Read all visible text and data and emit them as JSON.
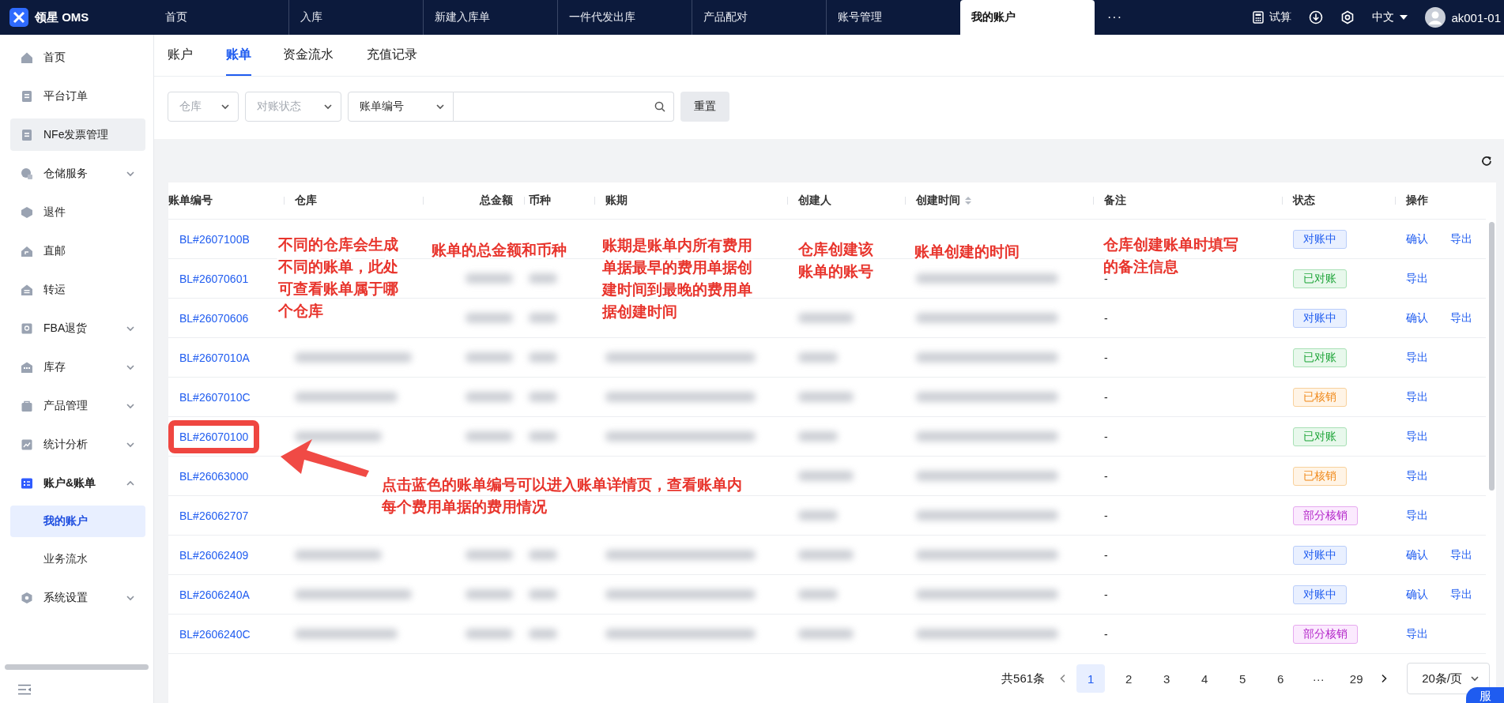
{
  "top_nav": {
    "logo": "领星 OMS",
    "tabs": [
      {
        "label": "首页",
        "selected": false
      },
      {
        "label": "入库",
        "selected": false
      },
      {
        "label": "新建入库单",
        "selected": false
      },
      {
        "label": "一件代发出库",
        "selected": false
      },
      {
        "label": "产品配对",
        "selected": false
      },
      {
        "label": "账号管理",
        "selected": false
      },
      {
        "label": "我的账户",
        "selected": true
      }
    ],
    "more": "···",
    "trial": "试算",
    "language": "中文",
    "user": "ak001-01"
  },
  "sidebar": {
    "items": [
      {
        "label": "首页",
        "kind": "link",
        "hovered": false
      },
      {
        "label": "平台订单",
        "kind": "link",
        "hovered": false
      },
      {
        "label": "NFe发票管理",
        "kind": "link",
        "hovered": true
      },
      {
        "label": "仓储服务",
        "kind": "group",
        "expanded": false,
        "hovered": false
      },
      {
        "label": "退件",
        "kind": "link",
        "hovered": false
      },
      {
        "label": "直邮",
        "kind": "link",
        "hovered": false
      },
      {
        "label": "转运",
        "kind": "link",
        "hovered": false
      },
      {
        "label": "FBA退货",
        "kind": "group",
        "expanded": false,
        "hovered": false
      },
      {
        "label": "库存",
        "kind": "group",
        "expanded": false,
        "hovered": false
      },
      {
        "label": "产品管理",
        "kind": "group",
        "expanded": false,
        "hovered": false
      },
      {
        "label": "统计分析",
        "kind": "group",
        "expanded": false,
        "hovered": false
      },
      {
        "label": "账户&账单",
        "kind": "group",
        "expanded": true,
        "hovered": false,
        "children": [
          {
            "label": "我的账户",
            "selected": true
          },
          {
            "label": "业务流水",
            "selected": false
          }
        ]
      },
      {
        "label": "系统设置",
        "kind": "group",
        "expanded": false,
        "hovered": false
      }
    ]
  },
  "sub_tabs": [
    {
      "label": "账户",
      "selected": false
    },
    {
      "label": "账单",
      "selected": true
    },
    {
      "label": "资金流水",
      "selected": false
    },
    {
      "label": "充值记录",
      "selected": false
    }
  ],
  "filters": {
    "warehouse": {
      "placeholder": "仓库"
    },
    "reconcile_status": {
      "placeholder": "对账状态"
    },
    "search_type": {
      "value": "账单编号"
    },
    "reset_button": "重置"
  },
  "table": {
    "columns": [
      {
        "label": "账单编号",
        "sortable": false
      },
      {
        "label": "仓库",
        "sortable": false
      },
      {
        "label": "总金额",
        "sortable": false
      },
      {
        "label": "币种",
        "sortable": false
      },
      {
        "label": "账期",
        "sortable": false
      },
      {
        "label": "创建人",
        "sortable": false
      },
      {
        "label": "创建时间",
        "sortable": true
      },
      {
        "label": "备注",
        "sortable": false
      },
      {
        "label": "状态",
        "sortable": false
      },
      {
        "label": "操作",
        "sortable": false
      }
    ],
    "rows": [
      {
        "bill_no": "BL#2607100B",
        "highlighted": false,
        "status": {
          "label": "对账中",
          "kind": "pending"
        },
        "actions": [
          "确认",
          "导出"
        ]
      },
      {
        "bill_no": "BL#26070601",
        "highlighted": false,
        "remark": "-",
        "status": {
          "label": "已对账",
          "kind": "reconciled"
        },
        "actions": [
          "导出"
        ]
      },
      {
        "bill_no": "BL#26070606",
        "highlighted": false,
        "remark": "-",
        "status": {
          "label": "对账中",
          "kind": "pending"
        },
        "actions": [
          "确认",
          "导出"
        ]
      },
      {
        "bill_no": "BL#2607010A",
        "highlighted": false,
        "remark": "-",
        "status": {
          "label": "已对账",
          "kind": "reconciled"
        },
        "actions": [
          "导出"
        ]
      },
      {
        "bill_no": "BL#2607010C",
        "highlighted": false,
        "remark": "-",
        "status": {
          "label": "已核销",
          "kind": "written_off"
        },
        "actions": [
          "导出"
        ]
      },
      {
        "bill_no": "BL#26070100",
        "highlighted": true,
        "remark": "-",
        "status": {
          "label": "已对账",
          "kind": "reconciled"
        },
        "actions": [
          "导出"
        ]
      },
      {
        "bill_no": "BL#26063000",
        "highlighted": false,
        "remark": "-",
        "status": {
          "label": "已核销",
          "kind": "written_off"
        },
        "actions": [
          "导出"
        ]
      },
      {
        "bill_no": "BL#26062707",
        "highlighted": false,
        "remark": "-",
        "status": {
          "label": "部分核销",
          "kind": "partial"
        },
        "actions": [
          "导出"
        ]
      },
      {
        "bill_no": "BL#26062409",
        "highlighted": false,
        "remark": "-",
        "status": {
          "label": "对账中",
          "kind": "pending"
        },
        "actions": [
          "确认",
          "导出"
        ]
      },
      {
        "bill_no": "BL#2606240A",
        "highlighted": false,
        "remark": "-",
        "status": {
          "label": "对账中",
          "kind": "pending"
        },
        "actions": [
          "确认",
          "导出"
        ]
      },
      {
        "bill_no": "BL#2606240C",
        "highlighted": false,
        "remark": "-",
        "status": {
          "label": "部分核销",
          "kind": "partial"
        },
        "actions": [
          "导出"
        ]
      }
    ]
  },
  "pagination": {
    "total": "共561条",
    "pages": [
      {
        "label": "1",
        "selected": true
      },
      {
        "label": "2",
        "selected": false
      },
      {
        "label": "3",
        "selected": false
      },
      {
        "label": "4",
        "selected": false
      },
      {
        "label": "5",
        "selected": false
      },
      {
        "label": "6",
        "selected": false
      },
      {
        "label": "···",
        "selected": false
      },
      {
        "label": "29",
        "selected": false
      }
    ],
    "page_size": "20条/页"
  },
  "annotations": [
    {
      "text": "不同的仓库会生成不同的账单，此处可查看账单属于哪个仓库",
      "kind": "note"
    },
    {
      "text": "账单的总金额和币种",
      "kind": "note"
    },
    {
      "text": "账期是账单内所有费用单据最早的费用单据创建时间到最晚的费用单据创建时间",
      "kind": "note"
    },
    {
      "text": "仓库创建该账单的账号",
      "kind": "note"
    },
    {
      "text": "账单创建的时间",
      "kind": "note"
    },
    {
      "text": "仓库创建账单时填写的备注信息",
      "kind": "note"
    },
    {
      "text": "点击蓝色的账单编号可以进入账单详情页，查看账单内每个费用单据的费用情况",
      "kind": "arrow_note"
    }
  ],
  "chat_button": "服"
}
